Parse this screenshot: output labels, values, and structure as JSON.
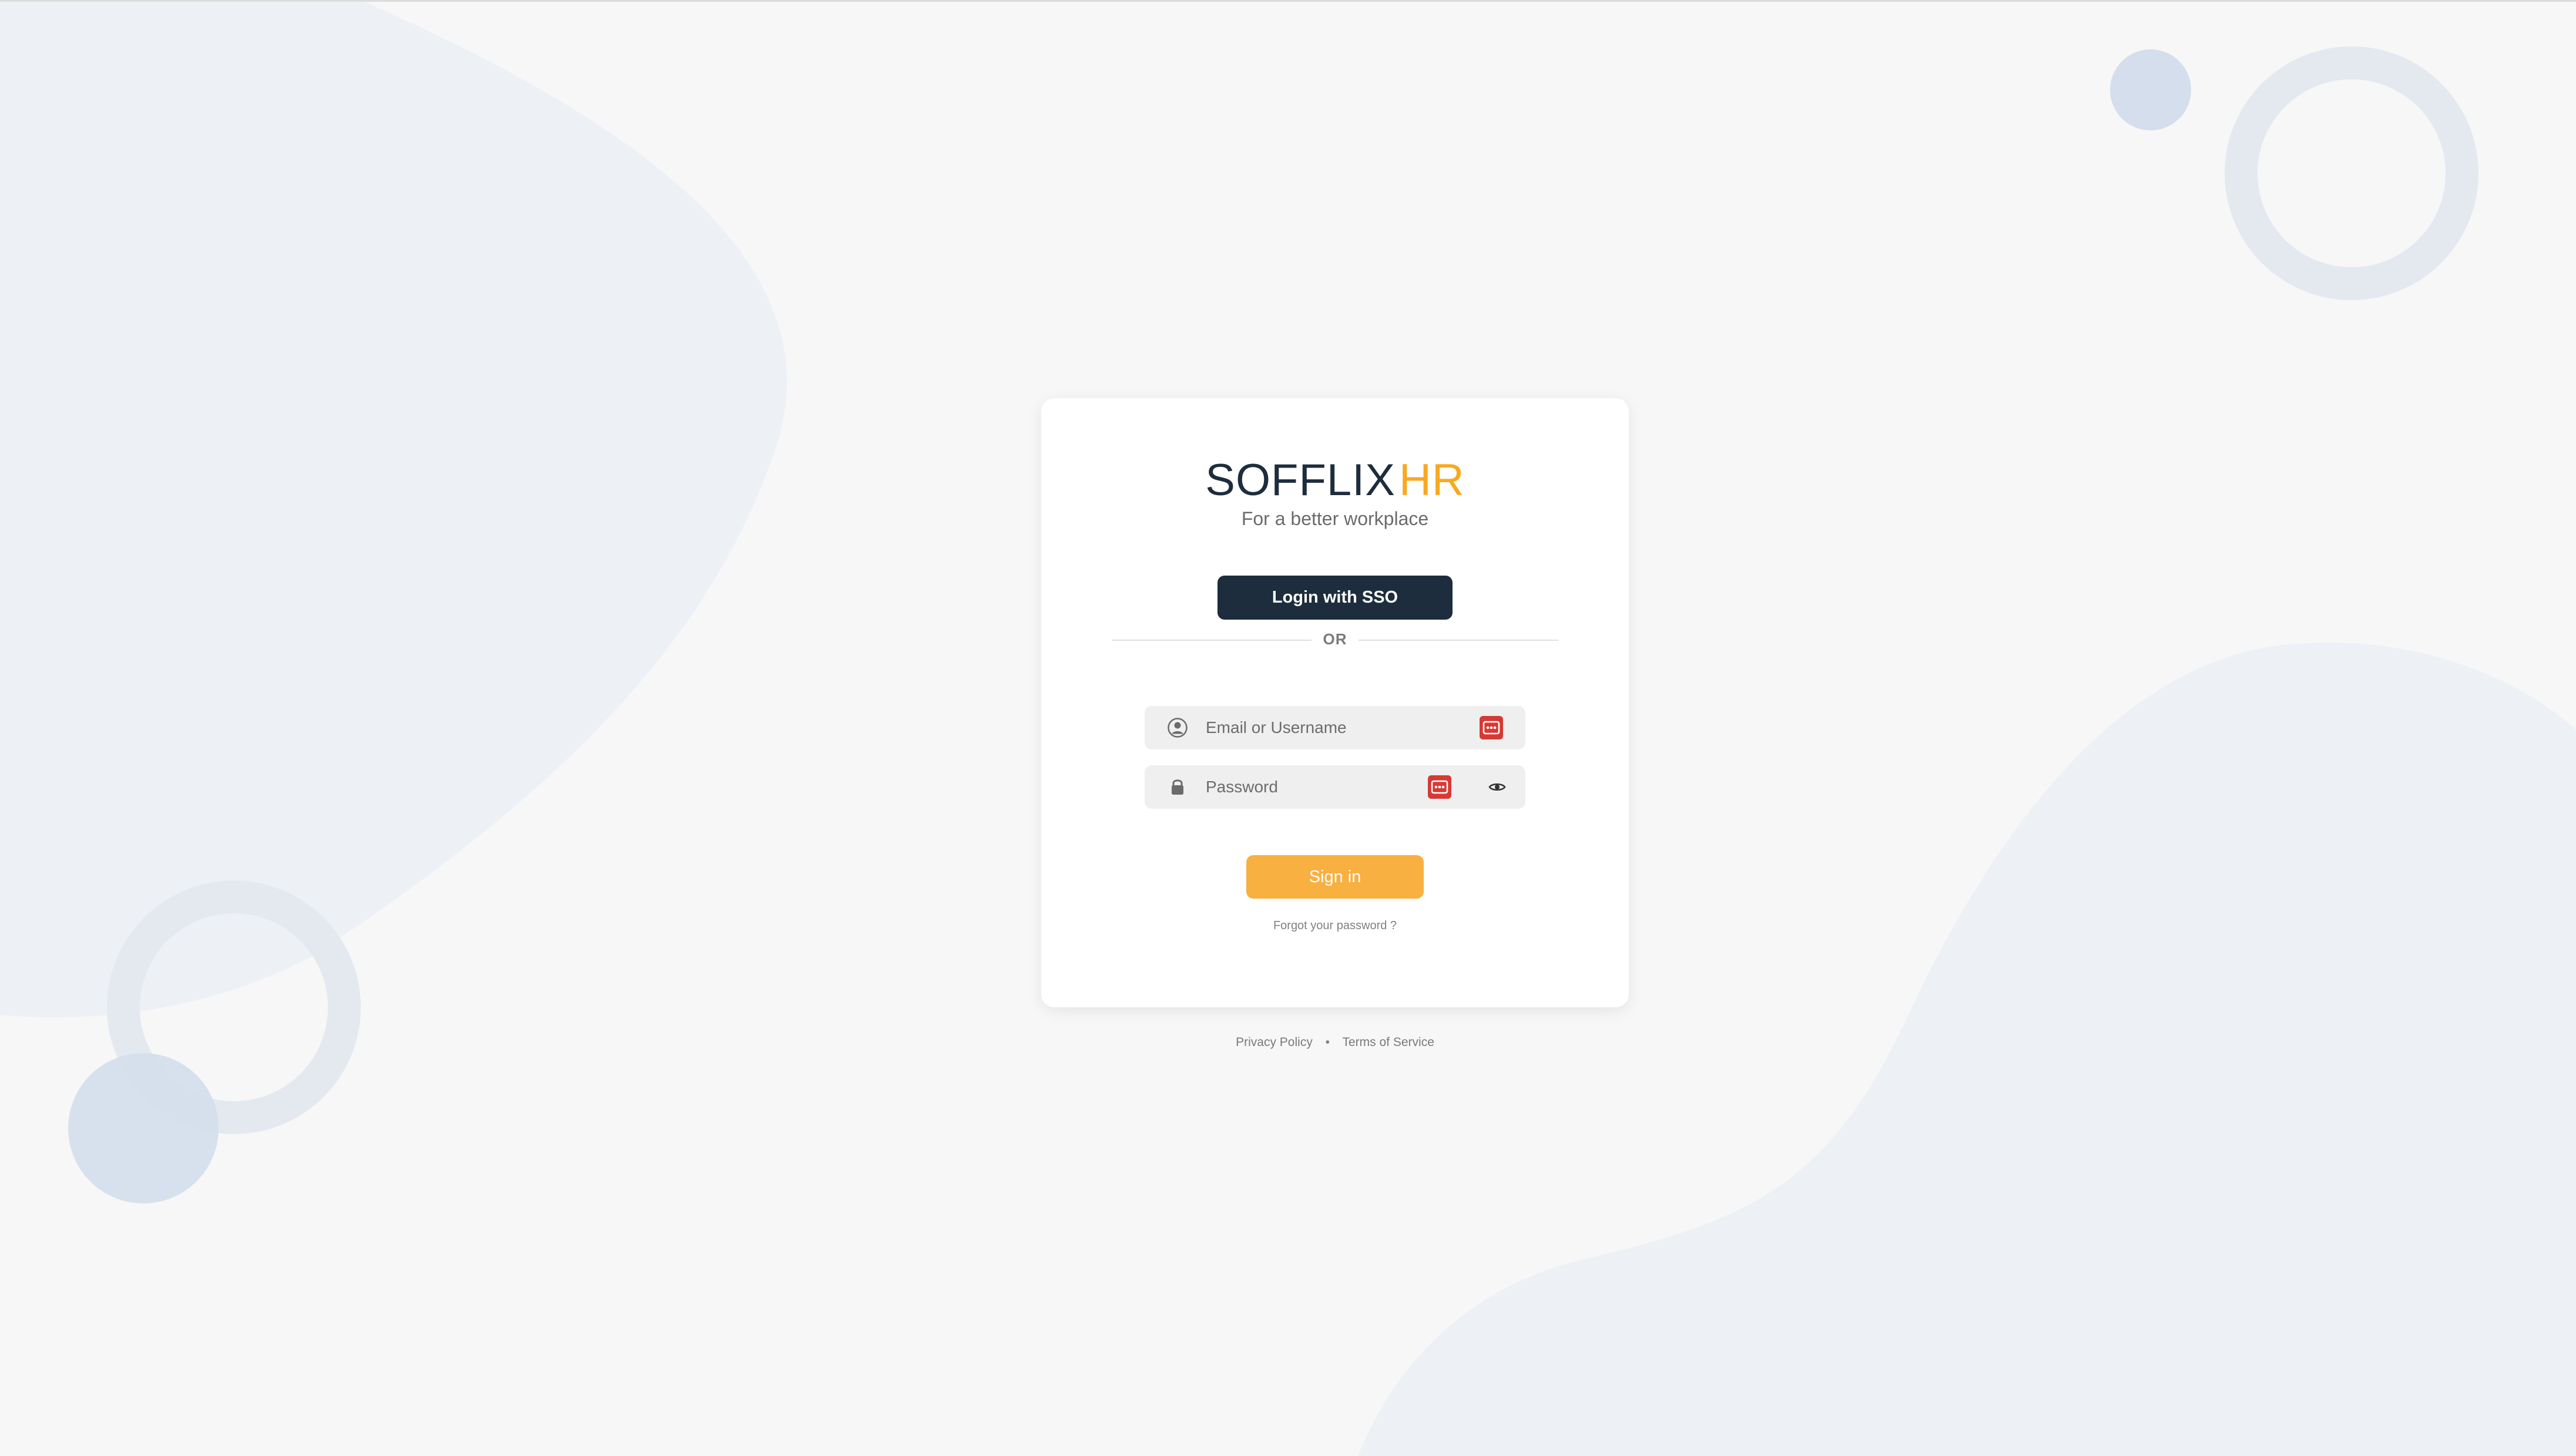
{
  "brand": {
    "logo_main": "SOFFLIX",
    "logo_accent": "HR",
    "tagline": "For a better workplace",
    "primary_color": "#1e2d3d",
    "accent_color": "#f8a920"
  },
  "sso": {
    "label": "Login with SSO"
  },
  "divider": {
    "label": "OR"
  },
  "form": {
    "username": {
      "placeholder": "Email or Username",
      "value": "",
      "icon": "user-circle-icon"
    },
    "password": {
      "placeholder": "Password",
      "value": "",
      "icon": "lock-icon",
      "toggle_icon": "eye-icon"
    },
    "password_manager_icon": "password-manager-icon",
    "password_manager_color": "#d63a35",
    "submit_label": "Sign in",
    "submit_color": "#f8b040",
    "forgot_label": "Forgot your password ?"
  },
  "footer": {
    "privacy_label": "Privacy Policy",
    "separator": "•",
    "terms_label": "Terms of Service"
  }
}
